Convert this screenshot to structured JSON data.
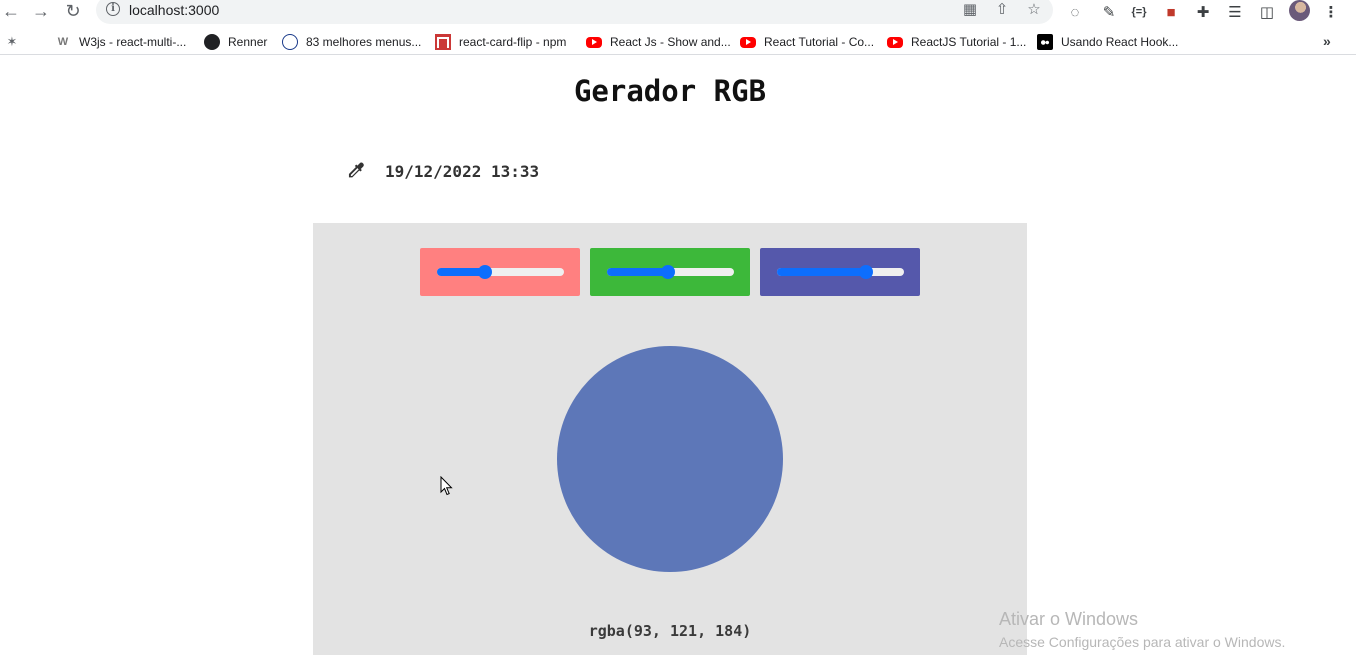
{
  "browser": {
    "url": "localhost:3000",
    "bookmarks": [
      {
        "label": "W3js - react-multi-...",
        "icon": "w3js-icon"
      },
      {
        "label": "Renner",
        "icon": "globe-icon"
      },
      {
        "label": "83 melhores menus...",
        "icon": "rocket-icon"
      },
      {
        "label": "react-card-flip - npm",
        "icon": "npm-icon"
      },
      {
        "label": "React Js - Show and...",
        "icon": "youtube-icon"
      },
      {
        "label": "React Tutorial - Co...",
        "icon": "youtube-icon"
      },
      {
        "label": "ReactJS Tutorial - 1...",
        "icon": "youtube-icon"
      },
      {
        "label": "Usando React Hook...",
        "icon": "medium-icon"
      }
    ],
    "more_bookmarks": "»"
  },
  "page": {
    "title": "Gerador RGB",
    "datetime": "19/12/2022 13:33",
    "sliders": [
      {
        "name": "red",
        "color": "#ff8080",
        "value": 93,
        "max": 255
      },
      {
        "name": "green",
        "color": "#3db83a",
        "value": 121,
        "max": 255
      },
      {
        "name": "blue",
        "color": "#5558ab",
        "value": 184,
        "max": 255
      }
    ],
    "swatch_color": "#5d77b8",
    "rgba_label": "rgba(93, 121, 184)",
    "accent": "#0d6efd",
    "panel_bg": "#e3e3e3"
  },
  "watermark": {
    "line1": "Ativar o Windows",
    "line2": "Acesse Configurações para ativar o Windows."
  }
}
